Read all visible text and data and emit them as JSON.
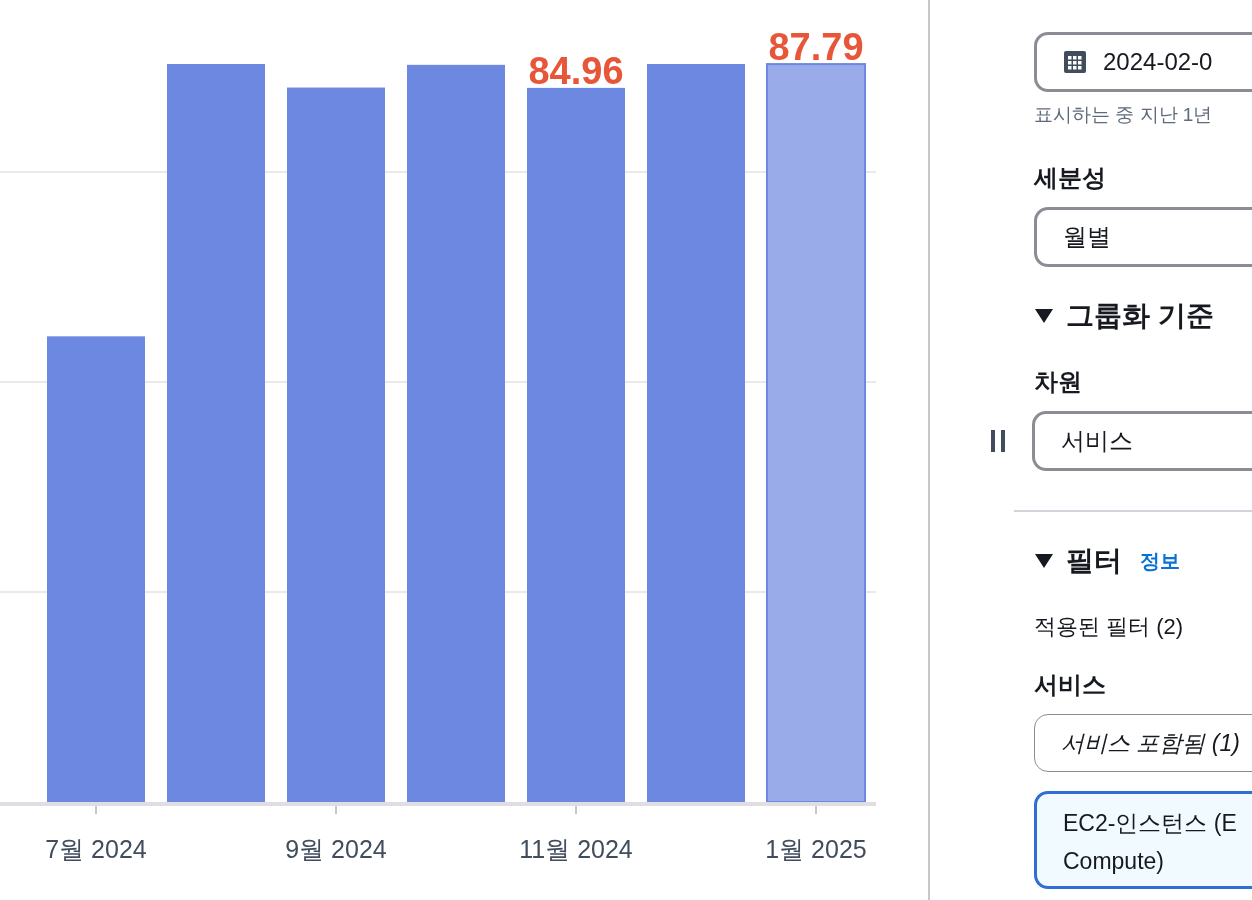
{
  "chart": {
    "chart_data": {
      "type": "bar",
      "categories": [
        "7월 2024",
        null,
        "9월 2024",
        null,
        "11월 2024",
        null,
        "1월 2025"
      ],
      "values": [
        55.4,
        87.8,
        85.0,
        87.7,
        84.96,
        87.8,
        87.79
      ],
      "value_labels": [
        null,
        null,
        null,
        null,
        "84.96",
        null,
        "87.79"
      ]
    },
    "bars": [
      {
        "selected": false
      },
      {
        "selected": false
      },
      {
        "selected": false
      },
      {
        "selected": false
      },
      {
        "selected": false
      },
      {
        "selected": false
      },
      {
        "selected": true
      }
    ]
  },
  "panel": {
    "date_range": {
      "value": "2024-02-0",
      "hint": "표시하는 중 지난 1년"
    },
    "granularity": {
      "label": "세분성",
      "value": "월별"
    },
    "group_by": {
      "heading": "그룹화 기준",
      "expanded": true,
      "dimension_label": "차원",
      "dimension_value": "서비스"
    },
    "filters": {
      "heading": "필터",
      "expanded": true,
      "info_link": "정보",
      "applied": "적용된 필터 (2)",
      "service_label": "서비스",
      "service_placeholder": "서비스 포함됨 (1)",
      "tokens": [
        {
          "lines": [
            "EC2-인스턴스 (E",
            "Compute)"
          ]
        }
      ]
    }
  }
}
